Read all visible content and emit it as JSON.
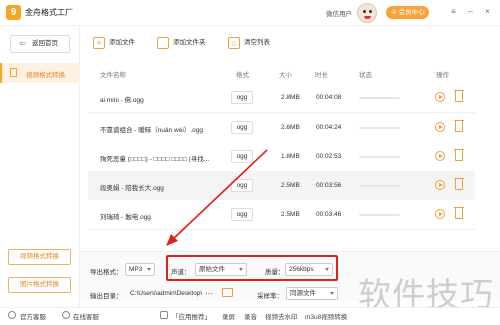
{
  "app": {
    "logo_glyph": "9",
    "title": "金舟格式工厂",
    "wechat_user": "微信用户",
    "vip_label": "会员中心",
    "window_controls": [
      "≡",
      "–",
      "×"
    ]
  },
  "sidebar": {
    "back_label": "返回首页",
    "active_item": "视频格式转换",
    "buttons": [
      "视频格式转换",
      "图片格式转换"
    ]
  },
  "toolbar": {
    "add_file": "添加文件",
    "add_folder": "添加文件夹",
    "clear_list": "清空列表"
  },
  "table": {
    "headers": [
      "文件名称",
      "格式",
      "大小",
      "时长",
      "状态",
      "操作"
    ],
    "rows": [
      {
        "name": "ai mini - 佛.ogg",
        "format": "ogg",
        "size": "2.8MB",
        "duration": "00:04:08"
      },
      {
        "name": "不靠谱组合 - 暧昧（nuǎn wèi）.ogg",
        "format": "ogg",
        "size": "2.6MB",
        "duration": "00:04:24"
      },
      {
        "name": "殉死恶童 (□□□□) - □□□□ □□□□ (寻找...",
        "format": "ogg",
        "size": "1.8MB",
        "duration": "00:02:53"
      },
      {
        "name": "段奥娟 - 陪我长大.ogg",
        "format": "ogg",
        "size": "2.5MB",
        "duration": "00:03:56"
      },
      {
        "name": "刘瑞琦 - 触电.ogg",
        "format": "ogg",
        "size": "2.5MB",
        "duration": "00:03:46"
      }
    ],
    "selected_row": 3
  },
  "output": {
    "format_label": "导出格式：",
    "format_value": "MP3",
    "channel_label": "声道：",
    "channel_value": "原始文件",
    "quality_label": "质量：",
    "quality_value": "256kbps",
    "dir_label": "输出目录：",
    "dir_value": "C:\\Users\\admin\\Desktop\\",
    "dir_more": "···",
    "samplerate_label": "采样率：",
    "samplerate_value": "同源文件"
  },
  "statusbar": [
    "官方客服",
    "在线客服",
    "「应用推荐」",
    "录屏",
    "录音",
    "视频去水印",
    "m3u8视频转换"
  ],
  "watermark": "软件技巧",
  "colors": {
    "accent": "#f5a623",
    "highlight": "#e0201c"
  }
}
